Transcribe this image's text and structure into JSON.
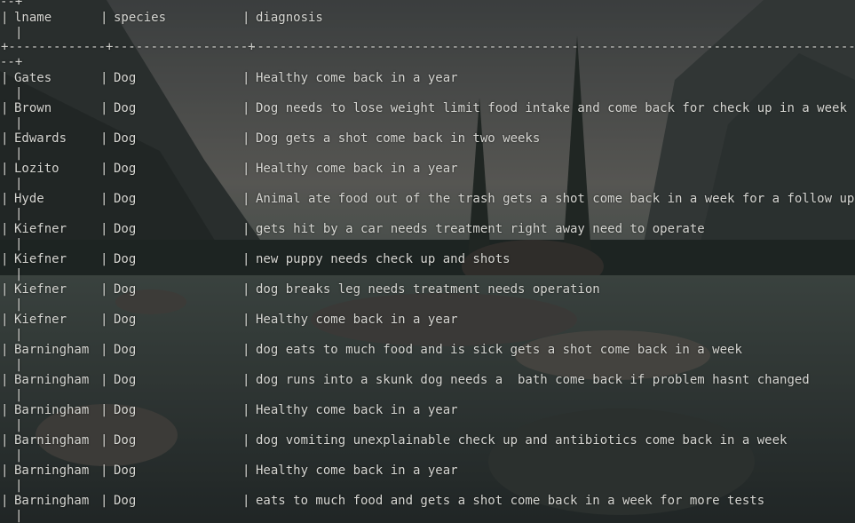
{
  "terminal": {
    "header_top": "--+",
    "header_pipe": "|",
    "separator_left": "+-------------+------------------+",
    "separator_dash_right": "----------------------------------------------------------------------------------------------",
    "separator_tail": "--+",
    "columns": {
      "lname": "lname",
      "species": "species",
      "diagnosis": "diagnosis"
    },
    "rows": [
      {
        "lname": "Gates",
        "species": "Dog",
        "diagnosis": "Healthy come back in a year"
      },
      {
        "lname": "Brown",
        "species": "Dog",
        "diagnosis": "Dog needs to lose weight limit food intake and come back for check up in a week"
      },
      {
        "lname": "Edwards",
        "species": "Dog",
        "diagnosis": "Dog gets a shot come back in two weeks"
      },
      {
        "lname": "Lozito",
        "species": "Dog",
        "diagnosis": "Healthy come back in a year"
      },
      {
        "lname": "Hyde",
        "species": "Dog",
        "diagnosis": "Animal ate food out of the trash gets a shot come back in a week for a follow up"
      },
      {
        "lname": "Kiefner",
        "species": "Dog",
        "diagnosis": "gets hit by a car needs treatment right away need to operate"
      },
      {
        "lname": "Kiefner",
        "species": "Dog",
        "diagnosis": "new puppy needs check up and shots"
      },
      {
        "lname": "Kiefner",
        "species": "Dog",
        "diagnosis": "dog breaks leg needs treatment needs operation"
      },
      {
        "lname": "Kiefner",
        "species": "Dog",
        "diagnosis": "Healthy come back in a year"
      },
      {
        "lname": "Barningham",
        "species": "Dog",
        "diagnosis": "dog eats to much food and is sick gets a shot come back in a week"
      },
      {
        "lname": "Barningham",
        "species": "Dog",
        "diagnosis": "dog runs into a skunk dog needs a  bath come back if problem hasnt changed"
      },
      {
        "lname": "Barningham",
        "species": "Dog",
        "diagnosis": "Healthy come back in a year"
      },
      {
        "lname": "Barningham",
        "species": "Dog",
        "diagnosis": "dog vomiting unexplainable check up and antibiotics come back in a week"
      },
      {
        "lname": "Barningham",
        "species": "Dog",
        "diagnosis": "Healthy come back in a year"
      },
      {
        "lname": "Barningham",
        "species": "Dog",
        "diagnosis": "eats to much food and gets a shot come back in a week for more tests"
      }
    ]
  },
  "colors": {
    "text": "#d6d6d2",
    "background": "#1f2326"
  }
}
